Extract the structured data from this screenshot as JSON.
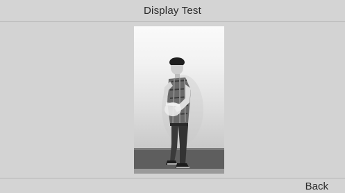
{
  "header": {
    "title": "Display Test"
  },
  "footer": {
    "back_label": "Back"
  },
  "main": {
    "test_image": "grayscale-person-photo"
  },
  "colors": {
    "background": "#d3d3d3",
    "text": "#2a2a2a",
    "divider": "#b4b4b4"
  }
}
